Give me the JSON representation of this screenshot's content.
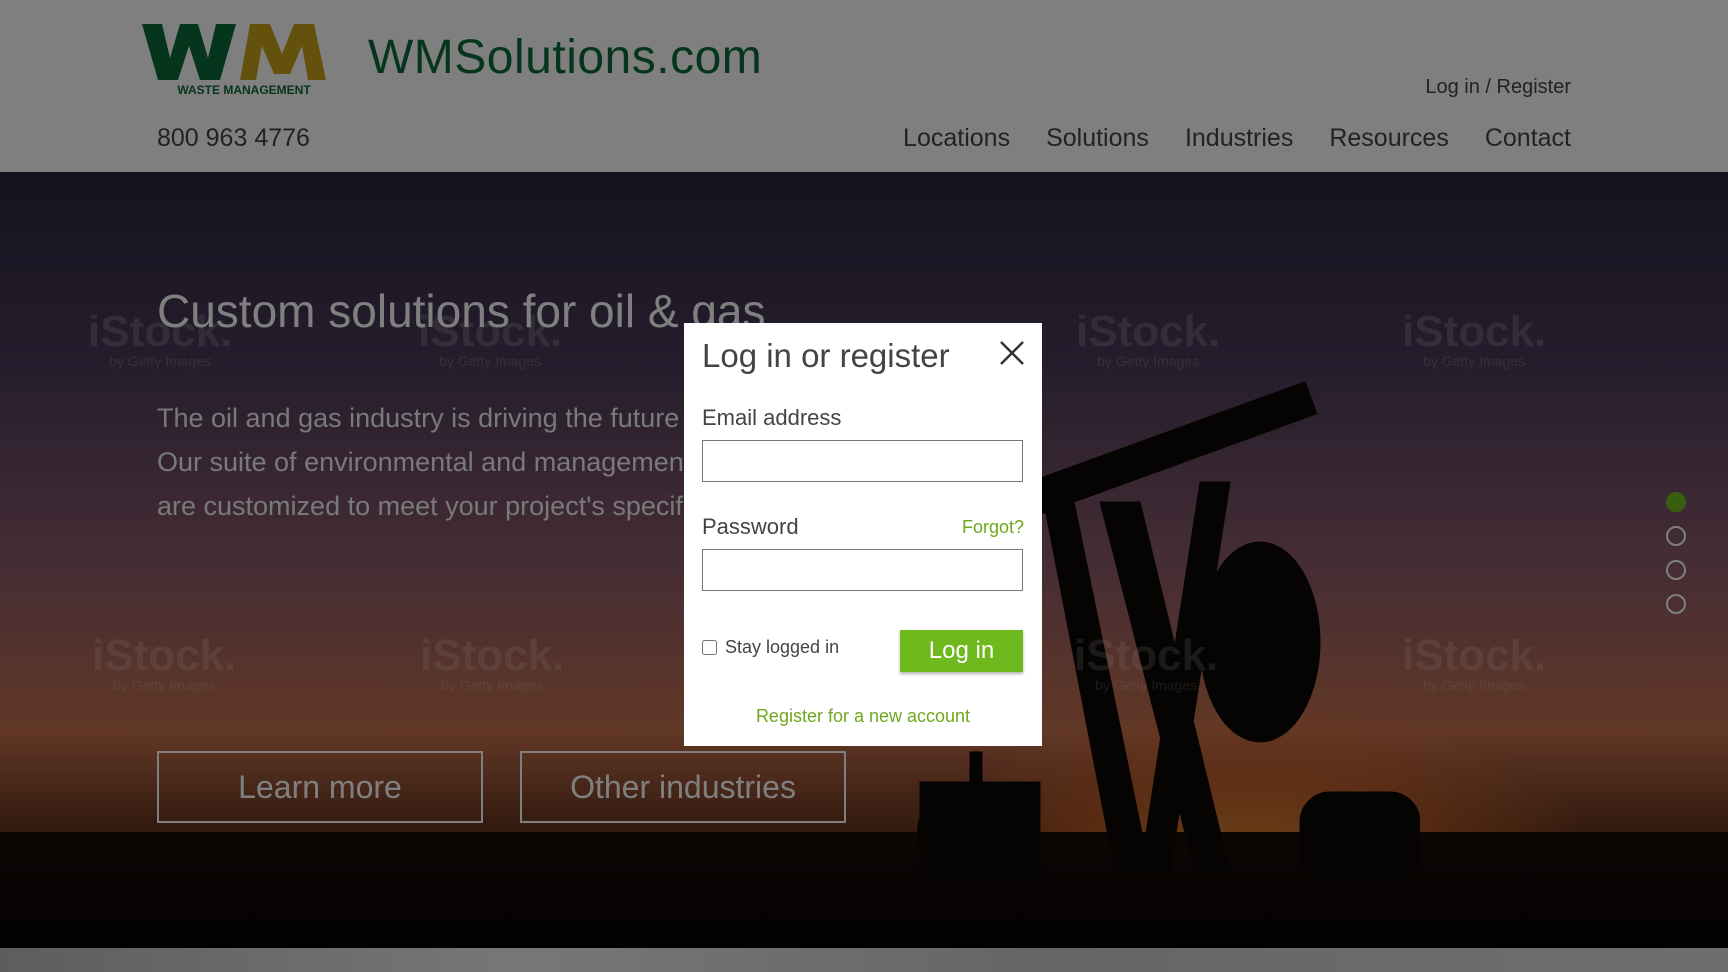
{
  "header": {
    "logo_text": "WASTE MANAGEMENT",
    "logo_letters": "WM",
    "site_name": "WMSolutions.com",
    "phone": "800 963 4776",
    "login_link": "Log in",
    "separator": "/",
    "register_link": "Register",
    "nav": [
      "Locations",
      "Solutions",
      "Industries",
      "Resources",
      "Contact"
    ]
  },
  "hero": {
    "title": "Custom solutions for oil & gas",
    "body_line1": "The oil and gas industry is driving the future of",
    "body_line2": "Our suite of environmental  and management",
    "body_line3": "are customized to meet your project's specific",
    "learn_more": "Learn more",
    "other_industries": "Other industries",
    "watermark_brand": "iStock.",
    "watermark_sub": "by Getty Images",
    "slides_total": 4,
    "slide_active": 1
  },
  "modal": {
    "title": "Log in or register",
    "email_label": "Email address",
    "email_value": "",
    "password_label": "Password",
    "password_value": "",
    "forgot": "Forgot?",
    "stay_logged_in": "Stay logged in",
    "stay_checked": false,
    "login_button": "Log in",
    "register": "Register for a new account"
  },
  "colors": {
    "brand_green": "#0b6b3a",
    "accent_green": "#6fb81e",
    "logo_gold": "#c9a21a"
  }
}
